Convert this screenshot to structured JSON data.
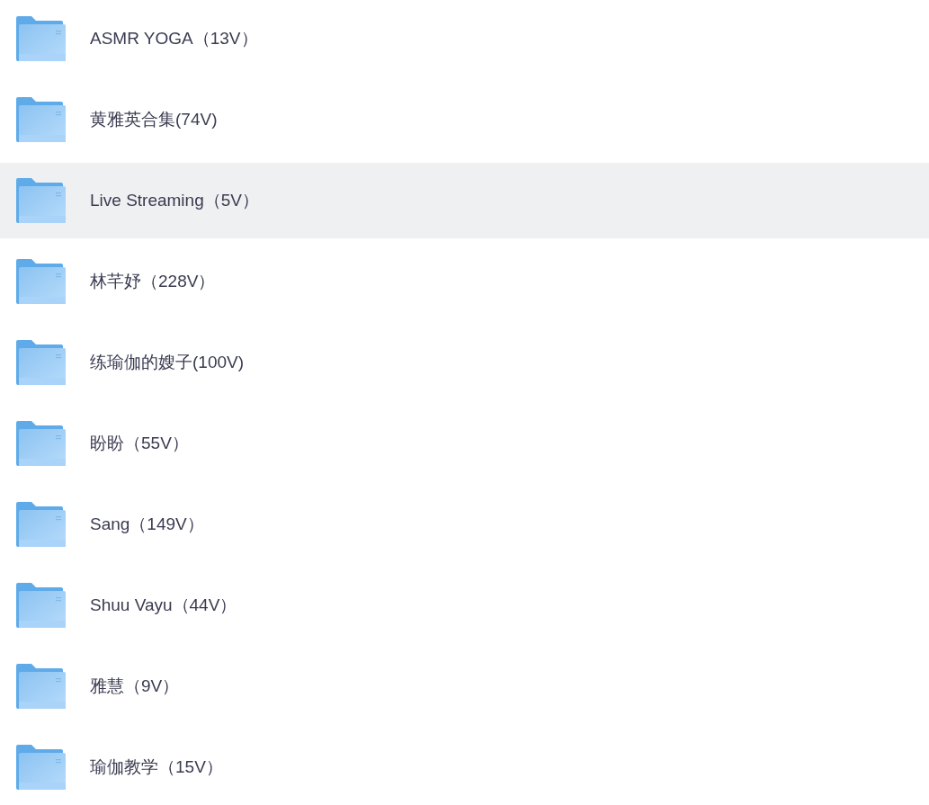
{
  "folders": [
    {
      "name": "ASMR YOGA（13V）",
      "selected": false
    },
    {
      "name": "黄雅英合集(74V)",
      "selected": false
    },
    {
      "name": "Live Streaming（5V）",
      "selected": true
    },
    {
      "name": "林芊妤（228V）",
      "selected": false
    },
    {
      "name": "练瑜伽的嫂子(100V)",
      "selected": false
    },
    {
      "name": "盼盼（55V）",
      "selected": false
    },
    {
      "name": "Sang（149V）",
      "selected": false
    },
    {
      "name": "Shuu Vayu（44V）",
      "selected": false
    },
    {
      "name": "雅慧（9V）",
      "selected": false
    },
    {
      "name": "瑜伽教学（15V）",
      "selected": false
    }
  ]
}
